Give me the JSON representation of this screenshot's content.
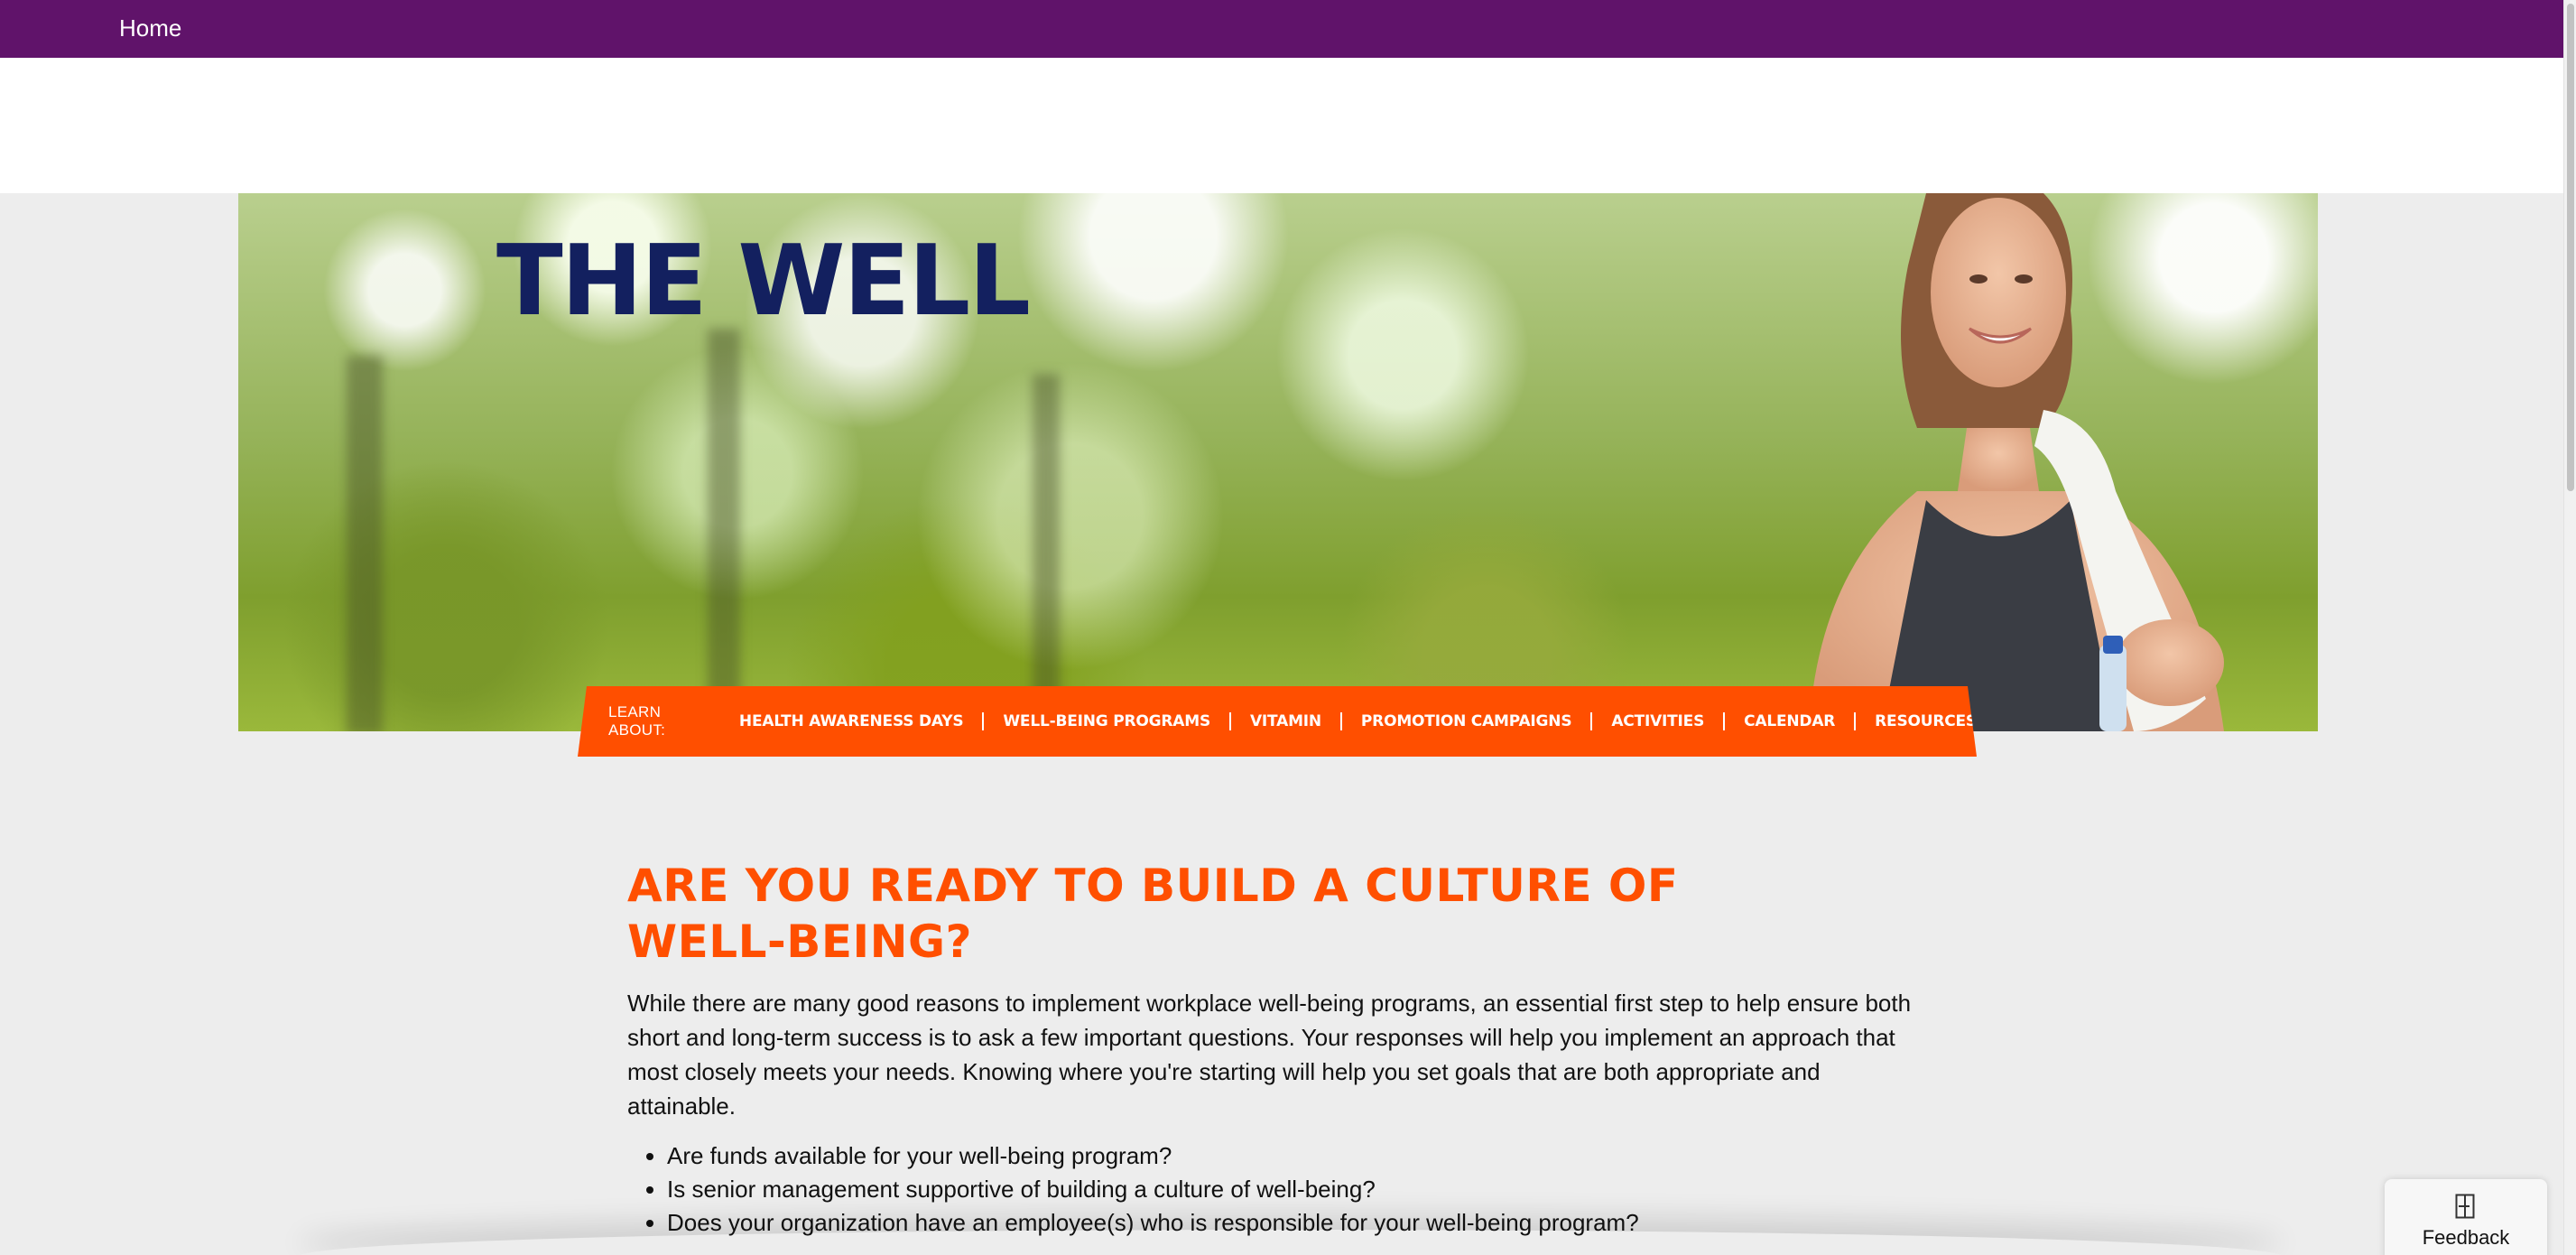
{
  "topbar": {
    "home_label": "Home",
    "bg_color": "#60136a"
  },
  "hero": {
    "title": "THE WELL",
    "title_color": "#13205f"
  },
  "nav": {
    "lead_label": "LEARN ABOUT:",
    "accent_color": "#ff4f00",
    "items": [
      {
        "label": "HEALTH AWARENESS DAYS"
      },
      {
        "label": "WELL-BEING PROGRAMS"
      },
      {
        "label": "VITAMIN"
      },
      {
        "label": "PROMOTION CAMPAIGNS"
      },
      {
        "label": "ACTIVITIES"
      },
      {
        "label": "CALENDAR"
      },
      {
        "label": "RESOURCES"
      }
    ]
  },
  "main": {
    "heading": "ARE YOU READY TO BUILD A CULTURE OF WELL-BEING?",
    "intro": "While there are many good reasons to implement workplace well-being programs, an essential first step to help ensure both short and long-term success is to ask a few important questions. Your responses will help you implement an approach that most closely meets your needs. Knowing where you're starting will help you set goals that are both appropriate and attainable.",
    "questions": [
      "Are funds available for your well-being program?",
      "Is senior management supportive of building a culture of well-being?",
      "Does your organization have an employee(s) who is responsible for your well-being program?"
    ]
  },
  "feedback": {
    "label": "Feedback",
    "icon": "feedback-icon"
  }
}
